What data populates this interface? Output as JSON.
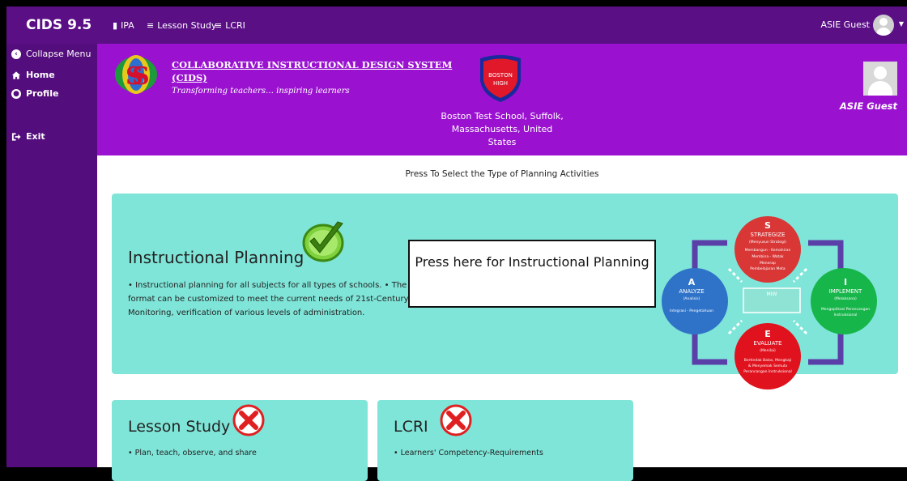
{
  "topbar": {
    "brand": "CIDS 9.5",
    "links": [
      {
        "icon": "file-icon",
        "label": "IPA"
      },
      {
        "icon": "list-icon",
        "label": "Lesson Study"
      },
      {
        "icon": "list-icon",
        "label": "LCRI"
      }
    ],
    "user_name": "ASIE Guest"
  },
  "sidebar": {
    "items": [
      {
        "label": "Collapse Menu",
        "icon": "chevron-left-icon"
      },
      {
        "label": "Home",
        "icon": "home-icon"
      },
      {
        "label": "Profile",
        "icon": "user-icon"
      },
      {
        "label": "Exit",
        "icon": "exit-icon"
      }
    ]
  },
  "banner": {
    "system_title": "COLLABORATIVE INSTRUCTIONAL DESIGN SYSTEM",
    "system_abbr": "(CIDS)",
    "tagline": "Transforming teachers… inspiring learners",
    "shield_line1": "BOSTON",
    "shield_line2": "HIGH",
    "school_line1": "Boston Test School, Suffolk,",
    "school_line2": "Massachusetts, United",
    "school_line3": "States",
    "profile_name": "ASIE Guest"
  },
  "main": {
    "prompt": "Press To Select the Type of Planning Activities",
    "instructional": {
      "title": "Instructional Planning",
      "desc_line1": "• Instructional planning for all subjects for all types of schools. • The flexible planning",
      "desc_line2": "format can be customized to meet the current needs of 21st-Century Education. •",
      "desc_line3": "Monitoring, verification of various levels of administration.",
      "callout": "Press here for Instructional Planning"
    },
    "cycle": {
      "s_letter": "S",
      "s_title": "STRATEGIZE",
      "s_sub": "(Menyusun Strategi)",
      "s_body1": "Membangun - Kemahiran",
      "s_body2": "Membina - Watak",
      "s_body3": "Menerap",
      "s_body4": "Pembelajaran Meta",
      "a_letter": "A",
      "a_title": "ANALYZE",
      "a_sub": "(Analisis)",
      "a_body": "Integrasi - Pengetahuan",
      "i_letter": "I",
      "i_title": "IMPLEMENT",
      "i_sub": "(Melaksana)",
      "i_body1": "Mengaplikasi Perancangan",
      "i_body2": "Instruksional",
      "e_letter": "E",
      "e_title": "EVALUATE",
      "e_sub": "(Menilai)",
      "e_body1": "Bertindak Balas, Mengkaji",
      "e_body2": "& Menyemak Semula",
      "e_body3": "Perancangan Instruksional",
      "center_title": "MIW"
    },
    "lesson_study": {
      "title": "Lesson Study",
      "desc": "• Plan, teach, observe, and share"
    },
    "lcri": {
      "title": "LCRI",
      "desc": "• Learners' Competency-Requirements"
    }
  },
  "colors": {
    "navbar": "#5a0f85",
    "sidebar": "#540d7c",
    "banner": "#9a12d0",
    "card": "#7fe5d8"
  }
}
